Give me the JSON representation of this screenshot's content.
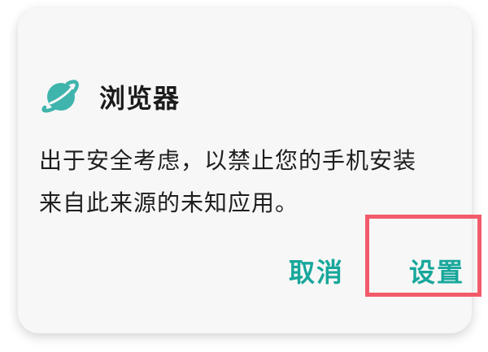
{
  "dialog": {
    "app_name": "浏览器",
    "app_icon": "planet-icon",
    "message_line1": "出于安全考虑，以禁止您的手机安装",
    "message_line2": "来自此来源的未知应用。",
    "cancel_label": "取消",
    "settings_label": "设置"
  },
  "colors": {
    "accent": "#17a79b",
    "icon_teal": "#3fb4ac",
    "highlight": "#f25b6a",
    "dialog_bg": "#f7f7f7"
  }
}
